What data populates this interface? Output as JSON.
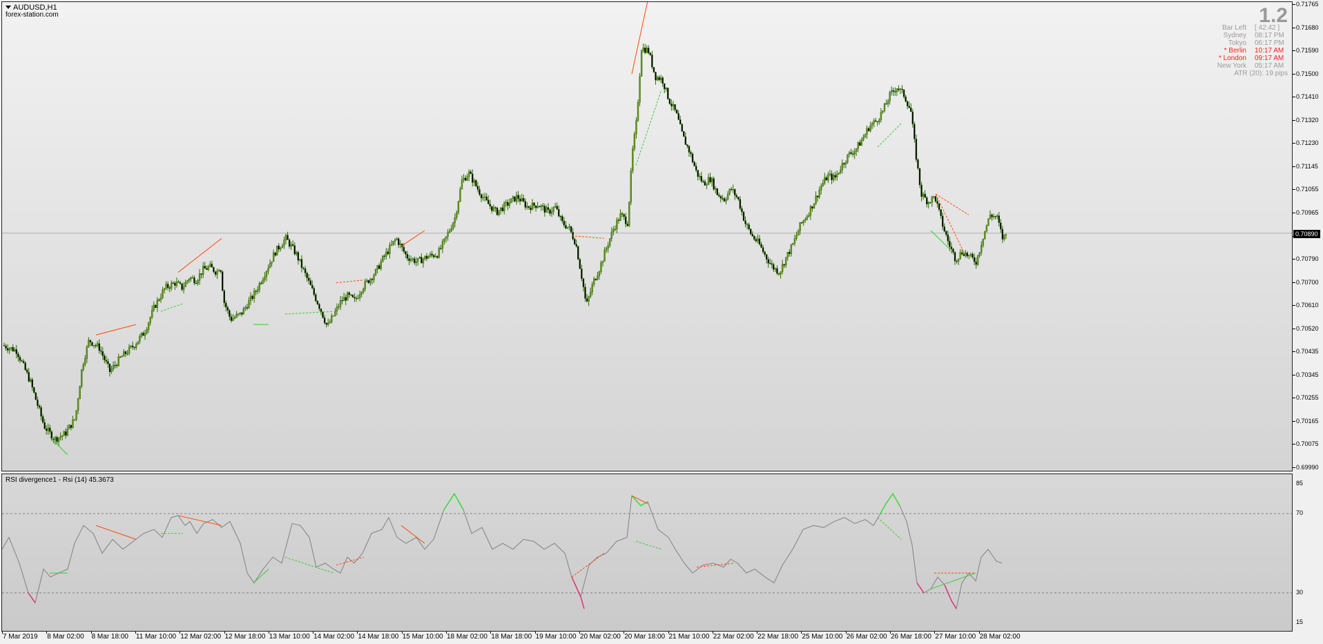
{
  "chart": {
    "symbol": "AUDUSD,H1",
    "website": "forex-station.com",
    "current_price": "0.70890",
    "price_axis": [
      "0.71765",
      "0.71680",
      "0.71590",
      "0.71500",
      "0.71410",
      "0.71320",
      "0.71230",
      "0.71145",
      "0.71055",
      "0.70965",
      "0.70880",
      "0.70790",
      "0.70700",
      "0.70610",
      "0.70520",
      "0.70435",
      "0.70345",
      "0.70255",
      "0.70165",
      "0.70075",
      "0.69990"
    ],
    "time_axis": [
      "7 Mar 2019",
      "8 Mar 02:00",
      "8 Mar 18:00",
      "11 Mar 10:00",
      "12 Mar 02:00",
      "12 Mar 18:00",
      "13 Mar 10:00",
      "14 Mar 02:00",
      "14 Mar 18:00",
      "15 Mar 10:00",
      "18 Mar 02:00",
      "18 Mar 18:00",
      "19 Mar 10:00",
      "20 Mar 02:00",
      "20 Mar 18:00",
      "21 Mar 10:00",
      "22 Mar 02:00",
      "22 Mar 18:00",
      "25 Mar 10:00",
      "26 Mar 02:00",
      "26 Mar 18:00",
      "27 Mar 10:00",
      "28 Mar 02:00"
    ]
  },
  "info_panel": {
    "big_value": "1.2",
    "rows": [
      {
        "label": "Bar Left",
        "value": "[ 42:42 ]",
        "highlight": false
      },
      {
        "label": "Sydney",
        "value": "08:17 PM",
        "highlight": false
      },
      {
        "label": "Tokyo",
        "value": "06:17 PM",
        "highlight": false
      },
      {
        "label": "* Berlin",
        "value": "10:17 AM",
        "highlight": true
      },
      {
        "label": "* London",
        "value": "09:17 AM",
        "highlight": true
      },
      {
        "label": "New York",
        "value": "05:17 AM",
        "highlight": false
      }
    ],
    "atr": "ATR (20): 19 pips"
  },
  "rsi": {
    "title": "RSI divergence1 - Rsi (14) 45.3673",
    "levels": [
      "85",
      "70",
      "30",
      "15"
    ]
  },
  "colors": {
    "bull_body": "#6b8e23",
    "bear_body": "#000000",
    "wick": "#2a6b00",
    "bear_div": "#ff4500",
    "bull_div": "#32cd32",
    "rsi_line": "#808080",
    "rsi_overbought": "#33dd33",
    "rsi_oversold": "#e0307a",
    "info_highlight": "#ff1a1a"
  },
  "chart_data": {
    "type": "candlestick",
    "symbol": "AUDUSD",
    "timeframe": "H1",
    "price_range": [
      0.6999,
      0.71765
    ],
    "close_path": [
      [
        0,
        0.7046
      ],
      [
        20,
        0.7044
      ],
      [
        40,
        0.7032
      ],
      [
        60,
        0.7015
      ],
      [
        75,
        0.701
      ],
      [
        90,
        0.7012
      ],
      [
        105,
        0.7018
      ],
      [
        115,
        0.7038
      ],
      [
        125,
        0.7048
      ],
      [
        140,
        0.7045
      ],
      [
        155,
        0.7036
      ],
      [
        170,
        0.7041
      ],
      [
        190,
        0.7046
      ],
      [
        205,
        0.7051
      ],
      [
        220,
        0.7061
      ],
      [
        235,
        0.7068
      ],
      [
        250,
        0.707
      ],
      [
        260,
        0.7068
      ],
      [
        270,
        0.7072
      ],
      [
        280,
        0.7071
      ],
      [
        290,
        0.7075
      ],
      [
        300,
        0.7076
      ],
      [
        310,
        0.7074
      ],
      [
        315,
        0.7077
      ],
      [
        320,
        0.7063
      ],
      [
        330,
        0.7056
      ],
      [
        345,
        0.7058
      ],
      [
        355,
        0.7062
      ],
      [
        365,
        0.7066
      ],
      [
        380,
        0.7074
      ],
      [
        395,
        0.7082
      ],
      [
        410,
        0.7087
      ],
      [
        425,
        0.7081
      ],
      [
        440,
        0.7072
      ],
      [
        450,
        0.7066
      ],
      [
        460,
        0.706
      ],
      [
        470,
        0.7053
      ],
      [
        480,
        0.7058
      ],
      [
        490,
        0.7063
      ],
      [
        500,
        0.7065
      ],
      [
        510,
        0.7063
      ],
      [
        520,
        0.7068
      ],
      [
        530,
        0.7071
      ],
      [
        540,
        0.7074
      ],
      [
        550,
        0.7079
      ],
      [
        560,
        0.7083
      ],
      [
        570,
        0.7087
      ],
      [
        585,
        0.708
      ],
      [
        600,
        0.7078
      ],
      [
        615,
        0.708
      ],
      [
        630,
        0.7081
      ],
      [
        640,
        0.7086
      ],
      [
        655,
        0.7095
      ],
      [
        665,
        0.7109
      ],
      [
        675,
        0.7112
      ],
      [
        690,
        0.7105
      ],
      [
        700,
        0.7101
      ],
      [
        715,
        0.7097
      ],
      [
        730,
        0.71
      ],
      [
        745,
        0.7103
      ],
      [
        760,
        0.7099
      ],
      [
        775,
        0.71
      ],
      [
        790,
        0.7097
      ],
      [
        800,
        0.7099
      ],
      [
        810,
        0.7093
      ],
      [
        820,
        0.7091
      ],
      [
        830,
        0.7085
      ],
      [
        840,
        0.707
      ],
      [
        845,
        0.7061
      ],
      [
        855,
        0.707
      ],
      [
        865,
        0.7076
      ],
      [
        875,
        0.7084
      ],
      [
        885,
        0.7091
      ],
      [
        895,
        0.7096
      ],
      [
        905,
        0.7093
      ],
      [
        912,
        0.712
      ],
      [
        918,
        0.7132
      ],
      [
        925,
        0.716
      ],
      [
        935,
        0.7159
      ],
      [
        945,
        0.7149
      ],
      [
        955,
        0.7148
      ],
      [
        965,
        0.714
      ],
      [
        975,
        0.7135
      ],
      [
        985,
        0.7126
      ],
      [
        995,
        0.712
      ],
      [
        1005,
        0.7112
      ],
      [
        1015,
        0.7108
      ],
      [
        1025,
        0.711
      ],
      [
        1035,
        0.7104
      ],
      [
        1045,
        0.7102
      ],
      [
        1055,
        0.7106
      ],
      [
        1065,
        0.7102
      ],
      [
        1075,
        0.7093
      ],
      [
        1085,
        0.7088
      ],
      [
        1095,
        0.7085
      ],
      [
        1105,
        0.708
      ],
      [
        1115,
        0.7076
      ],
      [
        1125,
        0.7074
      ],
      [
        1135,
        0.708
      ],
      [
        1145,
        0.7085
      ],
      [
        1155,
        0.7092
      ],
      [
        1165,
        0.7096
      ],
      [
        1175,
        0.7101
      ],
      [
        1185,
        0.7107
      ],
      [
        1195,
        0.7111
      ],
      [
        1205,
        0.711
      ],
      [
        1215,
        0.7115
      ],
      [
        1225,
        0.7119
      ],
      [
        1235,
        0.7121
      ],
      [
        1245,
        0.7125
      ],
      [
        1255,
        0.713
      ],
      [
        1265,
        0.7132
      ],
      [
        1275,
        0.7136
      ],
      [
        1285,
        0.7142
      ],
      [
        1295,
        0.7145
      ],
      [
        1305,
        0.7142
      ],
      [
        1315,
        0.7136
      ],
      [
        1322,
        0.712
      ],
      [
        1330,
        0.7104
      ],
      [
        1340,
        0.7101
      ],
      [
        1350,
        0.7103
      ],
      [
        1360,
        0.7093
      ],
      [
        1370,
        0.7085
      ],
      [
        1380,
        0.7079
      ],
      [
        1390,
        0.7082
      ],
      [
        1400,
        0.708
      ],
      [
        1410,
        0.7078
      ],
      [
        1420,
        0.7088
      ],
      [
        1430,
        0.7096
      ],
      [
        1440,
        0.7095
      ],
      [
        1448,
        0.7087
      ],
      [
        1455,
        0.7089
      ]
    ]
  }
}
